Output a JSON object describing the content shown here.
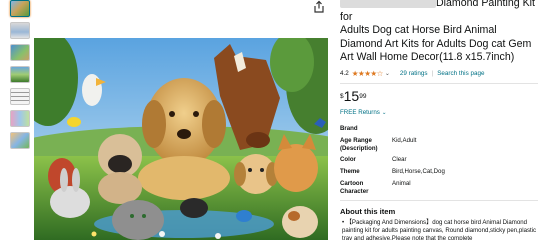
{
  "product": {
    "title_line1_visible": "Diamond Painting Kit for",
    "title_rest": "Adults Dog cat Horse Bird Animal Diamond Art Kits for Adults Dog cat Gem Art Wall Home Decor(11.8 x15.7inch)"
  },
  "rating": {
    "value": "4.2",
    "stars": "★★★★☆",
    "ratings_text": "29 ratings",
    "search_text": "Search this page"
  },
  "price": {
    "currency": "$",
    "whole": "15",
    "fraction": "99"
  },
  "returns": {
    "label": "FREE Returns"
  },
  "specs": [
    {
      "key": "Brand",
      "value": ""
    },
    {
      "key": "Age Range (Description)",
      "value": "Kid,Adult"
    },
    {
      "key": "Color",
      "value": "Clear"
    },
    {
      "key": "Theme",
      "value": "Bird,Horse,Cat,Dog"
    },
    {
      "key": "Cartoon Character",
      "value": "Animal"
    }
  ],
  "about": {
    "heading": "About this item",
    "body": "• 【Packaging And Dimensions】dog cat horse bird Animal Diamond painting kit for adults painting canvas, Round diamond,sticky pen,plastic tray and adhesive.Please note that the complete"
  },
  "icons": {
    "share": "share-icon",
    "rating_dropdown": "chevron-down-icon",
    "returns_dropdown": "chevron-down-icon"
  },
  "colors": {
    "link": "#007185",
    "star": "#de7921",
    "text": "#0f1111"
  }
}
